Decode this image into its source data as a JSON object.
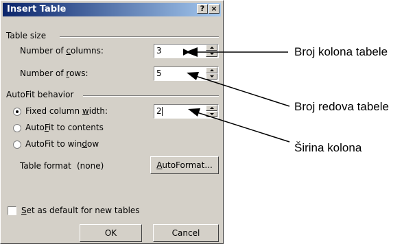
{
  "dialog": {
    "title": "Insert Table",
    "help_button": "?",
    "close_button": "×",
    "table_size": {
      "group_label": "Table size",
      "columns_label_pre": "Number of ",
      "columns_label_u": "c",
      "columns_label_post": "olumns:",
      "columns_value": "3",
      "rows_label_pre": "Number of ",
      "rows_label_u": "r",
      "rows_label_post": "ows:",
      "rows_value": "5"
    },
    "autofit": {
      "group_label": "AutoFit behavior",
      "fixed_pre": "Fixed column ",
      "fixed_u": "w",
      "fixed_post": "idth:",
      "fixed_value": "2",
      "contents_pre": "Auto",
      "contents_u": "F",
      "contents_post": "it to contents",
      "window_pre": "AutoFit to win",
      "window_u": "d",
      "window_post": "ow",
      "selected": "fixed"
    },
    "table_format": {
      "label": "Table format",
      "value": "(none)",
      "autoformat_u": "A",
      "autoformat_rest": "utoFormat..."
    },
    "default_checkbox": {
      "label_u": "S",
      "label_rest": "et as default for new tables",
      "checked": false
    },
    "ok_label": "OK",
    "cancel_label": "Cancel"
  },
  "annotations": {
    "columns": "Broj kolona tabele",
    "rows": "Broj redova tabele",
    "width": "Širina kolona"
  }
}
